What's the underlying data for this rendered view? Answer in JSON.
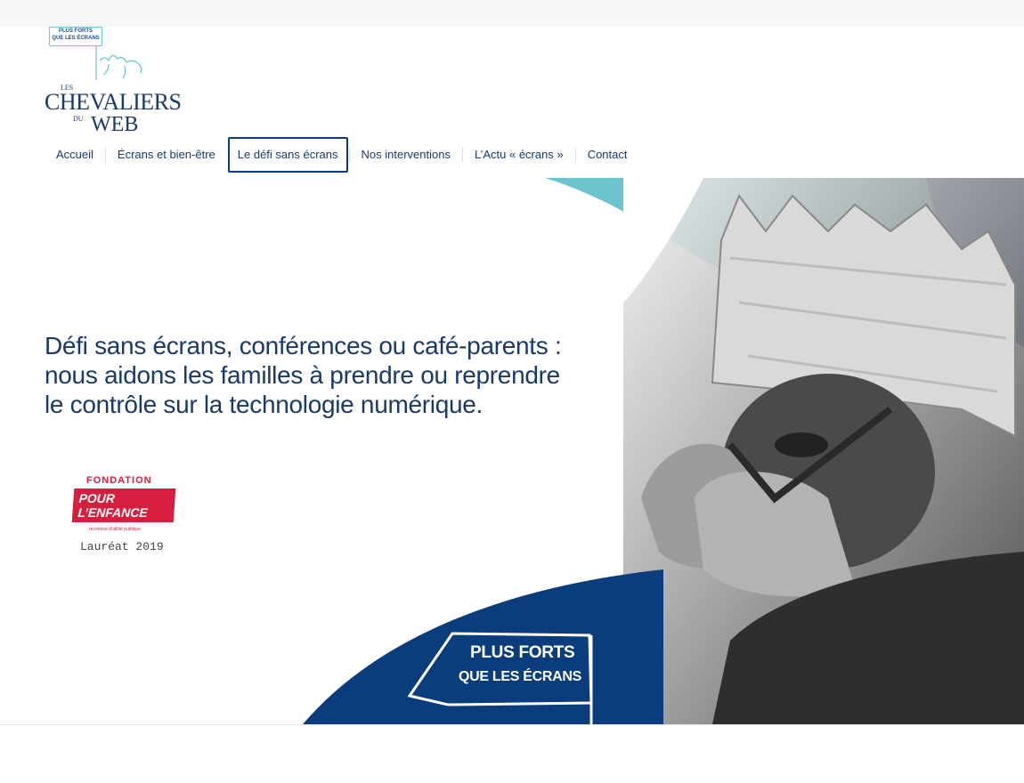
{
  "logo": {
    "pennant_line1": "PLUS FORTS",
    "pennant_line2": "QUE LES ÉCRANS",
    "les": "LES",
    "chevaliers": "CHEVALIERS",
    "du": "DU",
    "web": "WEB"
  },
  "nav": {
    "items": [
      {
        "label": "Accueil"
      },
      {
        "label": "Écrans et bien-être"
      },
      {
        "label": "Le défi sans écrans"
      },
      {
        "label": "Nos interventions"
      },
      {
        "label": "L’Actu « écrans »"
      },
      {
        "label": "Contact"
      }
    ],
    "active_index": 2
  },
  "hero": {
    "headline_line1": "Défi sans écrans, conférences ou café-parents :",
    "headline_line2": "nous aidons les familles à prendre ou reprendre",
    "headline_line3": "le contrôle sur la technologie numérique."
  },
  "fondation": {
    "label": "FONDATION",
    "line1": "POUR",
    "line2": "L’ENFANCE",
    "subtitle": "reconnue d’utilité publique",
    "laureat": "Lauréat 2019"
  },
  "flag": {
    "line1": "PLUS FORTS",
    "line2": "QUE LES ÉCRANS"
  },
  "colors": {
    "navy": "#0b3d7c",
    "teal": "#6cc4cf",
    "red": "#d81e3f",
    "text": "#1a3a6b"
  }
}
